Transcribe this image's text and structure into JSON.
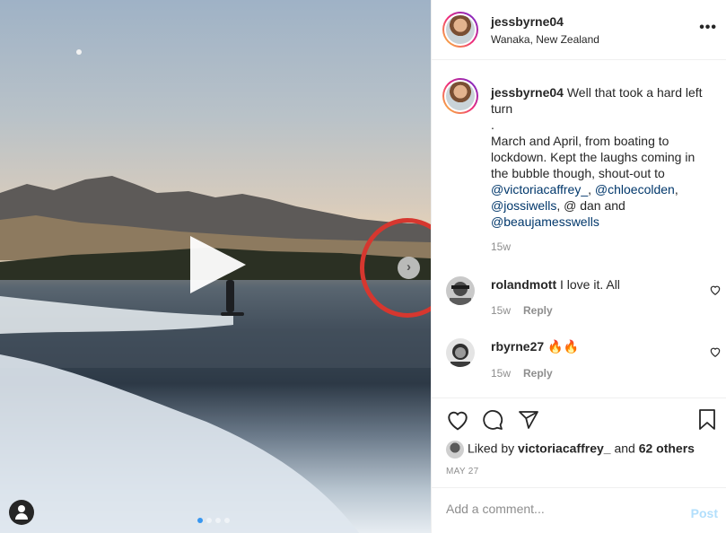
{
  "post": {
    "username": "jessbyrne04",
    "location": "Wanaka, New Zealand",
    "more_icon": "more-options-icon",
    "caption_username": "jessbyrne04",
    "caption_line1": " Well that took a hard left turn",
    "caption_dot": ".",
    "caption_line2": "March and April, from boating to lockdown. Kept the laughs coming in the bubble though, shout-out to",
    "mention1": "@victoriacaffrey_",
    "mention2": "@chloecolden",
    "mention3": "@jossiwells",
    "mention_sep": ", @ dan and",
    "mention4": "@beaujamesswells",
    "caption_time": "15w"
  },
  "comments": [
    {
      "username": "rolandmott",
      "text": "I love it. All",
      "time": "15w",
      "reply": "Reply"
    },
    {
      "username": "rbyrne27",
      "text": "🔥🔥",
      "time": "15w",
      "reply": "Reply"
    }
  ],
  "actions": {
    "liked_by_prefix": "Liked by",
    "liked_by_user": "victoriacaffrey_",
    "liked_by_and": "and",
    "liked_by_count": "62 others",
    "date": "MAY 27"
  },
  "add_comment": {
    "placeholder": "Add a comment...",
    "post_label": "Post"
  },
  "media": {
    "carousel_total": 4,
    "carousel_active": 1,
    "accent_annotation": "#d6372f"
  }
}
